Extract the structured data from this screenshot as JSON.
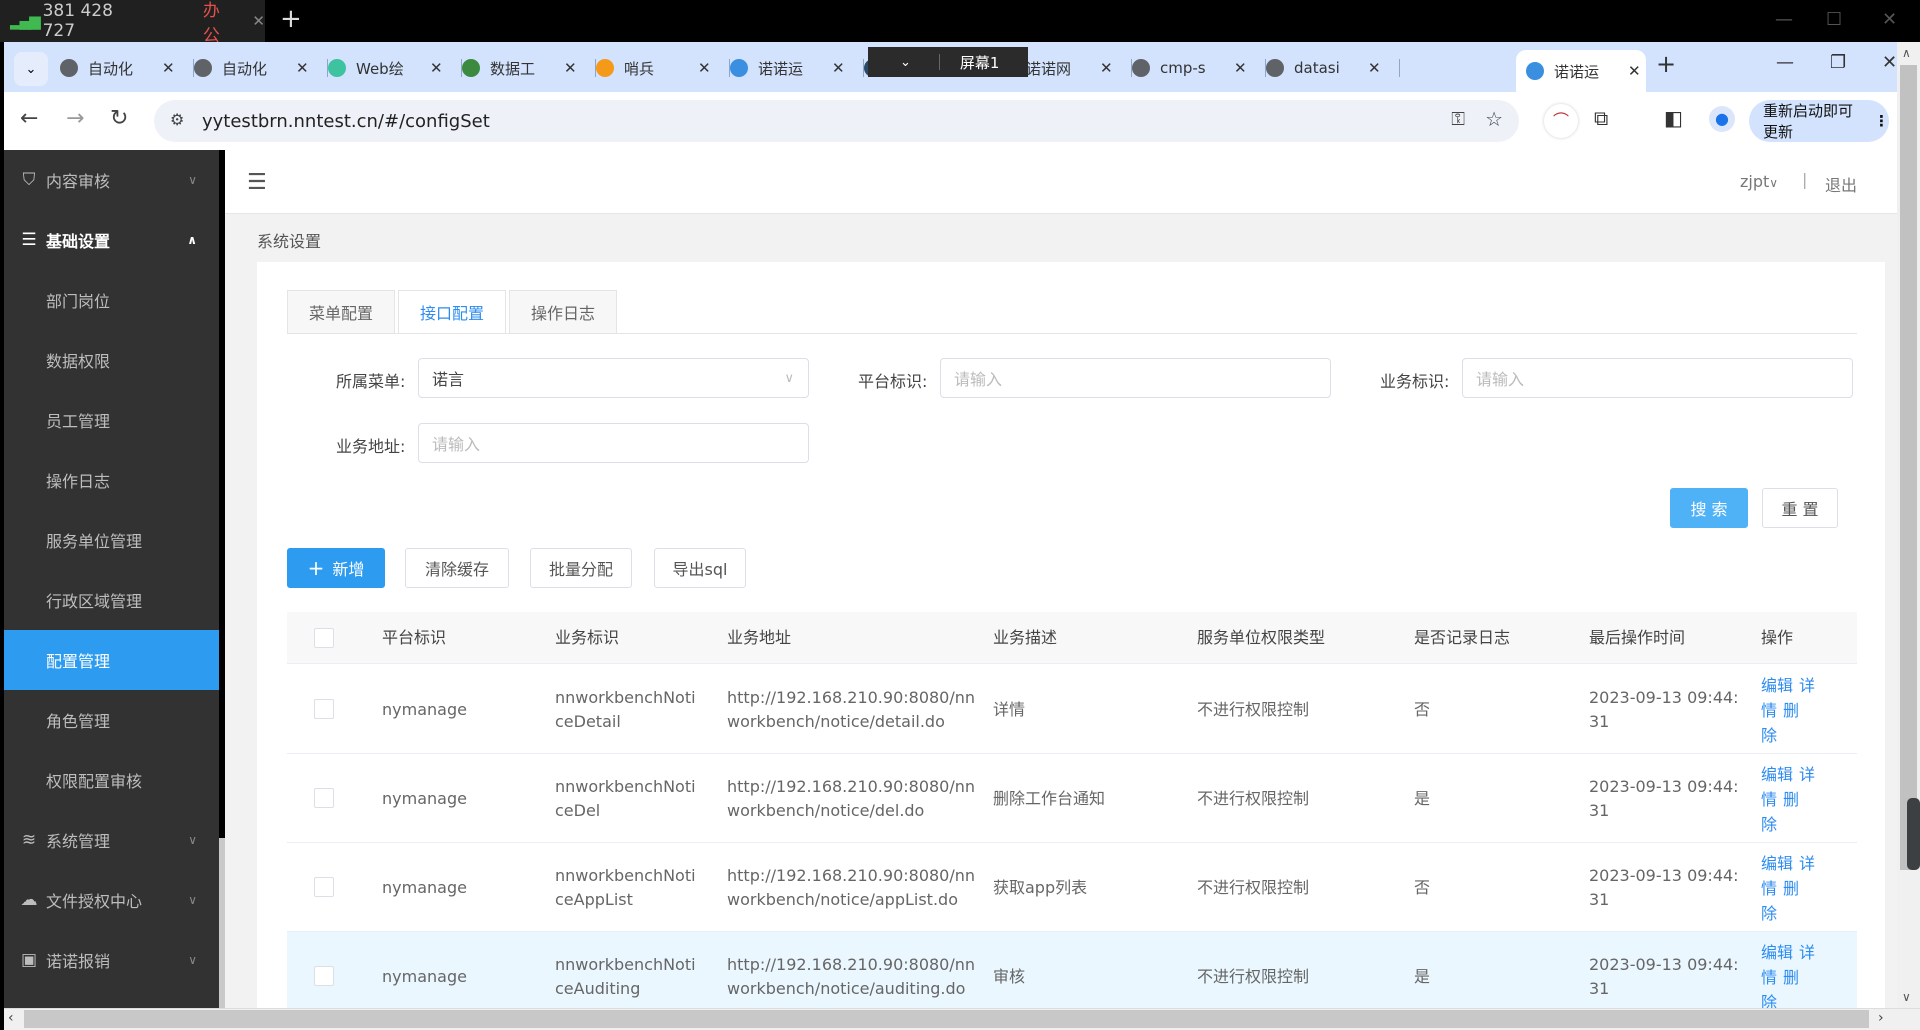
{
  "os": {
    "signal_text": "381 428 727",
    "workspace_tab": "办公",
    "screen_overlay": "屏幕1"
  },
  "browser": {
    "tabs": [
      {
        "title": "自动化",
        "icon": "globe-icon"
      },
      {
        "title": "自动化",
        "icon": "globe-icon"
      },
      {
        "title": "Web绘",
        "icon": "layers-icon"
      },
      {
        "title": "数据工",
        "icon": "green-dot-icon"
      },
      {
        "title": "哨兵",
        "icon": "sentinel-icon"
      },
      {
        "title": "诺诺运",
        "icon": "nuonuo-icon"
      },
      {
        "title": "诺诺网",
        "icon": "app-icon"
      },
      {
        "title": "诺诺网",
        "icon": "react-icon"
      },
      {
        "title": "cmp-s",
        "icon": "globe-icon"
      },
      {
        "title": "datasi",
        "icon": "globe-icon"
      },
      {
        "title": "诺诺运",
        "icon": "nuonuo-icon",
        "active": true
      }
    ],
    "url": "yytestbrn.nntest.cn/#/configSet",
    "update_button": "重新启动即可更新"
  },
  "sidebar": {
    "items": [
      {
        "label": "内容审核",
        "icon": "shield-check-icon",
        "type": "group"
      },
      {
        "label": "基础设置",
        "icon": "sliders-icon",
        "type": "group-open"
      },
      {
        "label": "部门岗位",
        "type": "sub"
      },
      {
        "label": "数据权限",
        "type": "sub"
      },
      {
        "label": "员工管理",
        "type": "sub"
      },
      {
        "label": "操作日志",
        "type": "sub"
      },
      {
        "label": "服务单位管理",
        "type": "sub"
      },
      {
        "label": "行政区域管理",
        "type": "sub"
      },
      {
        "label": "配置管理",
        "type": "sub-active"
      },
      {
        "label": "角色管理",
        "type": "sub"
      },
      {
        "label": "权限配置审核",
        "type": "sub"
      },
      {
        "label": "系统管理",
        "icon": "layers-icon",
        "type": "group"
      },
      {
        "label": "文件授权中心",
        "icon": "cloud-icon",
        "type": "group"
      },
      {
        "label": "诺诺报销",
        "icon": "reimburse-icon",
        "type": "group"
      }
    ]
  },
  "header": {
    "user": "zjpt",
    "logout": "退出",
    "breadcrumb": "系统设置"
  },
  "tabs": [
    {
      "label": "菜单配置"
    },
    {
      "label": "接口配置",
      "active": true
    },
    {
      "label": "操作日志"
    }
  ],
  "filters": {
    "menu_label": "所属菜单:",
    "menu_value": "诺言",
    "platform_label": "平台标识:",
    "platform_placeholder": "请输入",
    "biz_id_label": "业务标识:",
    "biz_id_placeholder": "请输入",
    "biz_addr_label": "业务地址:",
    "biz_addr_placeholder": "请输入",
    "search": "搜 索",
    "reset": "重 置"
  },
  "actions": {
    "add": "新增",
    "clear_cache": "清除缓存",
    "batch_assign": "批量分配",
    "export_sql": "导出sql"
  },
  "table": {
    "columns": [
      "平台标识",
      "业务标识",
      "业务地址",
      "业务描述",
      "服务单位权限类型",
      "是否记录日志",
      "最后操作时间",
      "操作"
    ],
    "rows": [
      {
        "platform": "nymanage",
        "biz_id": [
          "nnworkbenchNoti",
          "ceDetail"
        ],
        "addr": [
          "http://192.168.210.90:8080/nn",
          "workbench/notice/detail.do"
        ],
        "desc": "详情",
        "perm": "不进行权限控制",
        "log": "否",
        "time": [
          "2023-09-13 09:44:",
          "31"
        ]
      },
      {
        "platform": "nymanage",
        "biz_id": [
          "nnworkbenchNoti",
          "ceDel"
        ],
        "addr": [
          "http://192.168.210.90:8080/nn",
          "workbench/notice/del.do"
        ],
        "desc": "删除工作台通知",
        "perm": "不进行权限控制",
        "log": "是",
        "time": [
          "2023-09-13 09:44:",
          "31"
        ]
      },
      {
        "platform": "nymanage",
        "biz_id": [
          "nnworkbenchNoti",
          "ceAppList"
        ],
        "addr": [
          "http://192.168.210.90:8080/nn",
          "workbench/notice/appList.do"
        ],
        "desc": "获取app列表",
        "perm": "不进行权限控制",
        "log": "否",
        "time": [
          "2023-09-13 09:44:",
          "31"
        ]
      },
      {
        "platform": "nymanage",
        "biz_id": [
          "nnworkbenchNoti",
          "ceAuditing"
        ],
        "addr": [
          "http://192.168.210.90:8080/nn",
          "workbench/notice/auditing.do"
        ],
        "desc": "审核",
        "perm": "不进行权限控制",
        "log": "是",
        "time": [
          "2023-09-13 09:44:",
          "31"
        ],
        "highlighted": true
      }
    ],
    "row_ops": [
      "编辑",
      "详情",
      "删除"
    ]
  },
  "colors": {
    "accent": "#2d9cf0",
    "sidebar_bg": "#333233",
    "link": "#2d8cf0"
  }
}
